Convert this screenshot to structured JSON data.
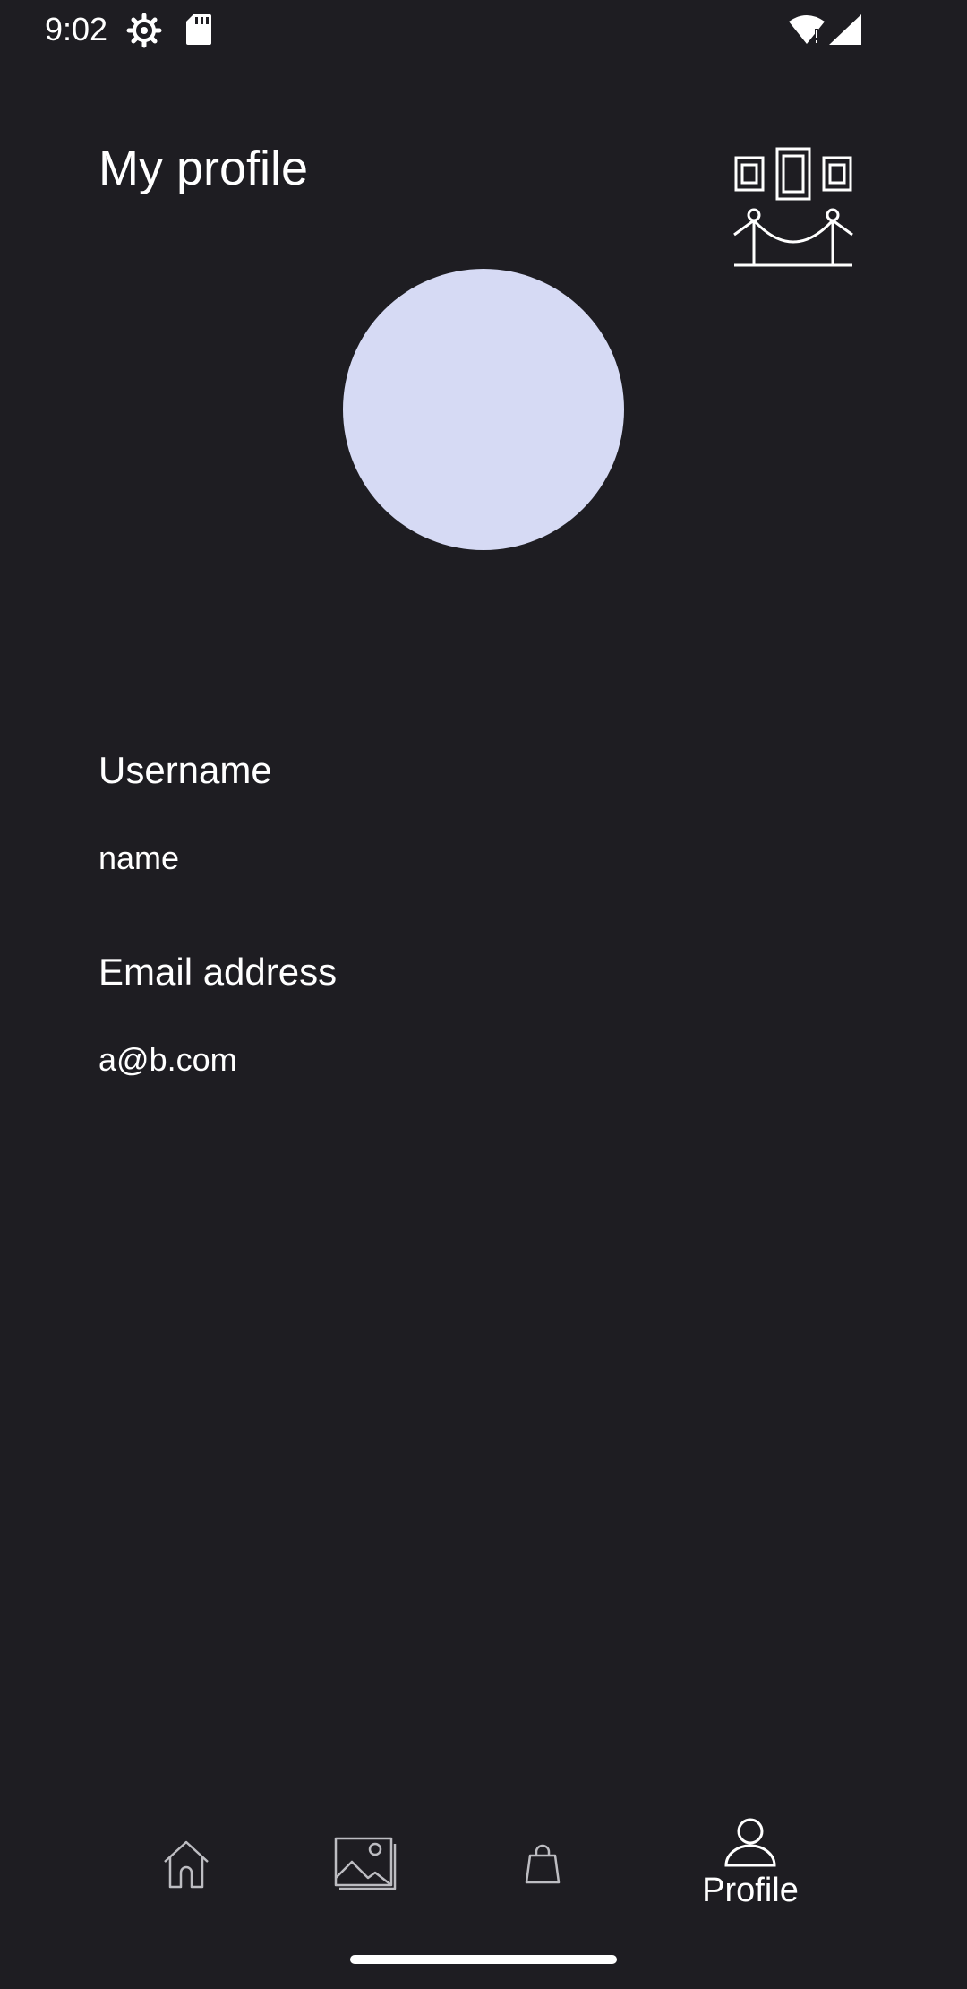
{
  "status_bar": {
    "time": "9:02",
    "icons": [
      "settings-gear-icon",
      "sd-card-icon",
      "wifi-icon",
      "cell-signal-icon"
    ]
  },
  "header": {
    "title": "My profile",
    "logo_icon": "gallery-frames-rope-icon"
  },
  "profile": {
    "avatar_color": "#d6daf4",
    "username_label": "Username",
    "username_value": "name",
    "email_label": "Email address",
    "email_value": "a@b.com"
  },
  "bottom_nav": {
    "items": [
      {
        "icon": "home-icon",
        "label": ""
      },
      {
        "icon": "gallery-icon",
        "label": ""
      },
      {
        "icon": "shopping-bag-icon",
        "label": ""
      },
      {
        "icon": "person-icon",
        "label": "Profile",
        "selected": true
      }
    ]
  },
  "colors": {
    "background": "#1e1d22",
    "text": "#ffffff",
    "avatar": "#d6daf4"
  }
}
